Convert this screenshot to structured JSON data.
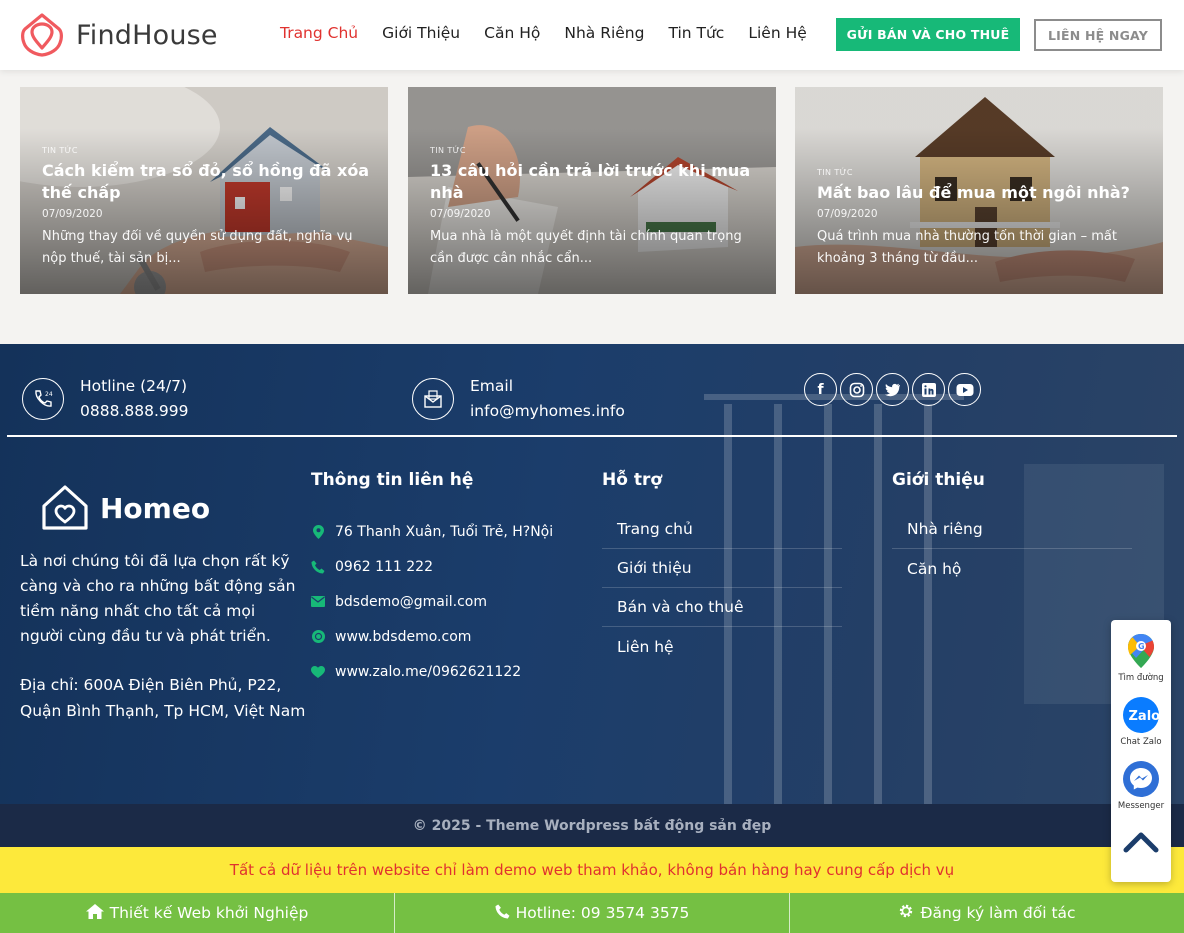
{
  "header": {
    "logo_text": "FindHouse",
    "nav": [
      "Trang Chủ",
      "Giới Thiệu",
      "Căn Hộ",
      "Nhà Riêng",
      "Tin Tức",
      "Liên Hệ"
    ],
    "cta_primary": "GỬI BÁN VÀ CHO THUÊ",
    "cta_secondary": "LIÊN HỆ NGAY"
  },
  "news": [
    {
      "category": "TIN TỨC",
      "title": "Cách kiểm tra sổ đỏ, sổ hồng đã xóa thế chấp",
      "date": "07/09/2020",
      "excerpt": "Những thay đổi về quyền sử dụng đất, nghĩa vụ nộp thuế, tài sản bị..."
    },
    {
      "category": "TIN TỨC",
      "title": "13 câu hỏi cần trả lời trước khi mua nhà",
      "date": "07/09/2020",
      "excerpt": "Mua nhà là một quyết định tài chính quan trọng cần được cân nhắc cẩn..."
    },
    {
      "category": "TIN TỨC",
      "title": "Mất bao lâu để mua một ngôi nhà?",
      "date": "07/09/2020",
      "excerpt": "Quá trình mua nhà thường tốn thời gian – mất khoảng 3 tháng từ đầu..."
    }
  ],
  "contact_bar": {
    "hotline_label": "Hotline (24/7)",
    "hotline_value": "0888.888.999",
    "email_label": "Email",
    "email_value": "info@myhomes.info",
    "socials": [
      "facebook-icon",
      "instagram-icon",
      "twitter-icon",
      "linkedin-icon",
      "youtube-icon"
    ]
  },
  "footer": {
    "brand": "Homeo",
    "about": "Là nơi chúng tôi đã lựa chọn rất kỹ càng và cho ra những bất động sản tiềm năng nhất cho tất cả mọi người cùng đầu tư và phát triển.",
    "address": "Địa chỉ: 600A Điện Biên Phủ, P22, Quận Bình Thạnh, Tp HCM, Việt Nam",
    "info_title": "Thông tin liên hệ",
    "info_items": [
      "76 Thanh Xuân, Tuổi Trẻ, H?Nội",
      "0962 111 222",
      "bdsdemo@gmail.com",
      "www.bdsdemo.com",
      "www.zalo.me/0962621122"
    ],
    "support_title": "Hỗ trợ",
    "support_links": [
      "Trang chủ",
      "Giới thiệu",
      "Bán và cho thuê",
      "Liên hệ"
    ],
    "intro_title": "Giới thiệu",
    "intro_links": [
      "Nhà riêng",
      "Căn hộ"
    ]
  },
  "copyright": "© 2025 - Theme Wordpress bất động sản đẹp",
  "notice": "Tất cả dữ liệu trên website chỉ làm demo web tham khảo, không bán hàng hay cung cấp dịch vụ",
  "bottom_bar": [
    "Thiết kế Web khởi Nghiệp",
    "Hotline: 09 3574 3575",
    "Đăng ký làm đối tác"
  ],
  "floating": [
    "Tìm đường",
    "Chat Zalo",
    "Messenger"
  ],
  "colors": {
    "accent_red": "#e0322f",
    "accent_green": "#17b978",
    "footer_blue": "#1b3d6b",
    "notice_yellow": "#fde93b",
    "bar_green": "#75c043"
  }
}
